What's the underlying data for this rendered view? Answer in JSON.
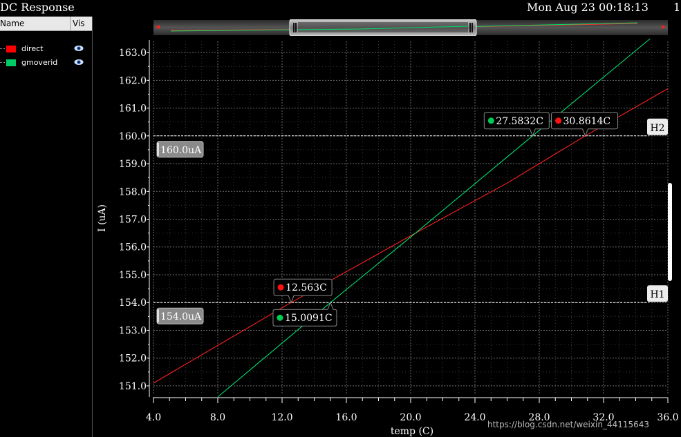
{
  "window": {
    "title": "DC Response",
    "datetime": "Mon Aug 23 00:18:13",
    "page_num": "1"
  },
  "legend": {
    "col_name": "Name",
    "col_vis": "Vis",
    "items": [
      {
        "label": "direct",
        "color": "#ff0000",
        "icon": "eye-icon"
      },
      {
        "label": "gmoverid",
        "color": "#00cc66",
        "icon": "eye-icon"
      }
    ]
  },
  "watermark": "https://blog.csdn.net/weixin_44115643",
  "chart_data": {
    "type": "line",
    "xlabel": "temp (C)",
    "ylabel": "I (uA)",
    "xlim": [
      4.0,
      36.0
    ],
    "ylim": [
      150.7,
      163.4
    ],
    "x_ticks": [
      "4.0",
      "8.0",
      "12.0",
      "16.0",
      "20.0",
      "24.0",
      "28.0",
      "32.0",
      "36.0"
    ],
    "y_ticks": [
      "151.0",
      "152.0",
      "153.0",
      "154.0",
      "155.0",
      "156.0",
      "157.0",
      "158.0",
      "159.0",
      "160.0",
      "161.0",
      "162.0",
      "163.0"
    ],
    "grid": true,
    "series": [
      {
        "name": "direct",
        "color": "#ff2020",
        "x": [
          4.0,
          12.563,
          20.3,
          26.0,
          30.8614,
          36.0
        ],
        "y": [
          151.1,
          154.0,
          156.5,
          158.3,
          160.0,
          161.7
        ]
      },
      {
        "name": "gmoverid",
        "color": "#00e070",
        "x": [
          8.0,
          15.0091,
          20.3,
          27.5832,
          34.9
        ],
        "y": [
          150.6,
          154.0,
          156.5,
          160.0,
          163.5
        ]
      }
    ],
    "h_markers": [
      {
        "label": "H2",
        "value": 160.0,
        "value_label": "160.0uA"
      },
      {
        "label": "H1",
        "value": 154.0,
        "value_label": "154.0uA"
      }
    ],
    "crossings": [
      {
        "label": "27.5832C",
        "x": 27.5832,
        "y": 160.0,
        "dot_color": "#00cc55"
      },
      {
        "label": "30.8614C",
        "x": 30.8614,
        "y": 160.0,
        "dot_color": "#ff1010"
      },
      {
        "label": "12.563C",
        "x": 12.563,
        "y": 154.0,
        "dot_color": "#ff1010"
      },
      {
        "label": "15.0091C",
        "x": 15.0091,
        "y": 154.0,
        "dot_color": "#00cc55"
      }
    ]
  }
}
